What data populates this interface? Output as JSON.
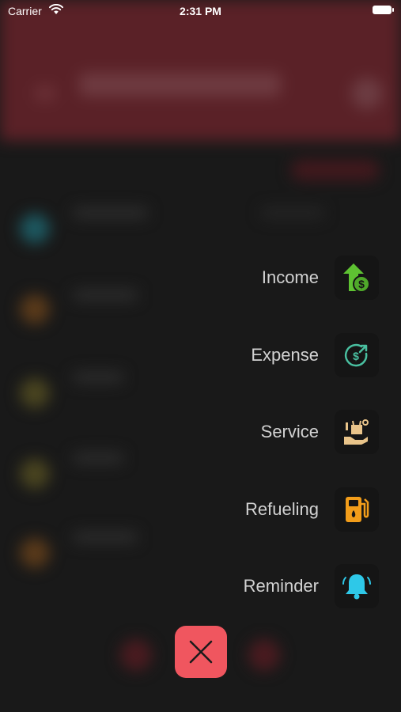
{
  "status_bar": {
    "carrier": "Carrier",
    "time": "2:31 PM",
    "icons": [
      "wifi-icon",
      "battery-icon"
    ]
  },
  "menu": {
    "items": [
      {
        "label": "Income",
        "icon": "income-icon",
        "color": "#5ec232"
      },
      {
        "label": "Expense",
        "icon": "expense-icon",
        "color": "#49bfa0"
      },
      {
        "label": "Service",
        "icon": "service-icon",
        "color": "#e9c48a"
      },
      {
        "label": "Refueling",
        "icon": "refueling-icon",
        "color": "#f29d1a"
      },
      {
        "label": "Reminder",
        "icon": "reminder-icon",
        "color": "#2ec8e8"
      }
    ],
    "close_icon": "close-icon",
    "close_color": "#f0565f"
  }
}
